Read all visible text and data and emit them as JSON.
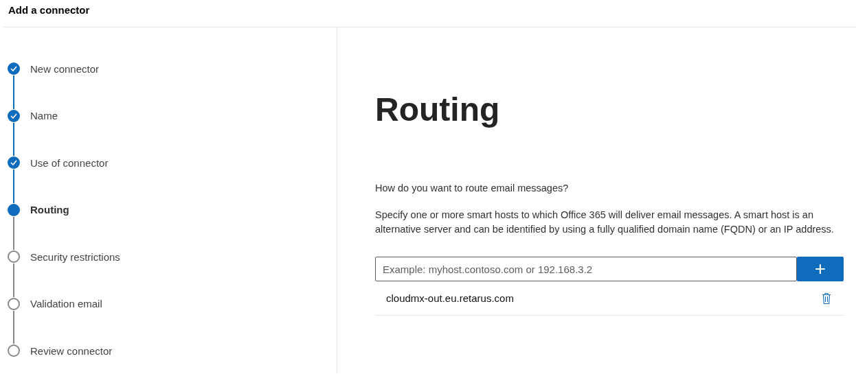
{
  "window": {
    "title": "Add a connector"
  },
  "steps": [
    {
      "label": "New connector",
      "completed": true,
      "selected": false
    },
    {
      "label": "Name",
      "completed": true,
      "selected": false
    },
    {
      "label": "Use of connector",
      "completed": true,
      "selected": false
    },
    {
      "label": "Routing",
      "completed": false,
      "selected": true
    },
    {
      "label": "Security restrictions",
      "completed": false,
      "selected": false
    },
    {
      "label": "Validation email",
      "completed": false,
      "selected": false
    },
    {
      "label": "Review connector",
      "completed": false,
      "selected": false
    }
  ],
  "content": {
    "heading": "Routing",
    "question": "How do you want to route email messages?",
    "description": "Specify one or more smart hosts to which Office 365 will deliver email messages. A smart host is an alternative server and can be identified by using a fully qualified domain name (FQDN) or an IP address.",
    "host_field": {
      "placeholder": "Example: myhost.contoso.com or 192.168.3.2"
    },
    "add_button": "+",
    "hosts": [
      "cloudmx-out.eu.retarus.com"
    ]
  }
}
